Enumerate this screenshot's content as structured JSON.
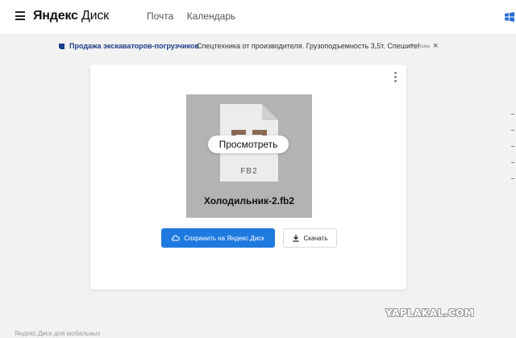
{
  "header": {
    "logo_brand": "Яндекс",
    "logo_product": "Диск",
    "nav": [
      {
        "label": "Почта"
      },
      {
        "label": "Календарь"
      }
    ]
  },
  "ad": {
    "link_text": "Продажа экскаваторов-погрузчиков",
    "text": "Спецтехника от производителя. Грузоподъемность 3,5т. Спешите!",
    "label": "Реклама",
    "close": "×"
  },
  "file": {
    "format_label": "FB2",
    "name": "Холодильник-2.fb2",
    "view_button": "Просмотреть"
  },
  "actions": {
    "save_label": "Сохранить на Яндекс.Диск",
    "download_label": "Скачать"
  },
  "watermark": "YAPLAKAL.COM",
  "footer": {
    "text": "Яндекс.Диск для мобильных"
  },
  "colors": {
    "primary": "#1f7ae0",
    "preview_bg": "#b3b3b3",
    "ad_link": "#1a3d8a"
  }
}
